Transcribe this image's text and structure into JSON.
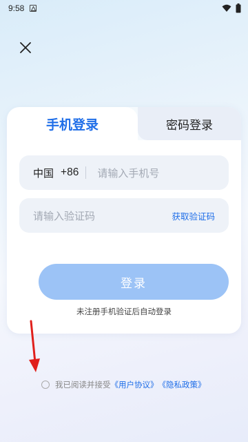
{
  "status_bar": {
    "time": "9:58"
  },
  "tabs": {
    "phone_login": "手机登录",
    "password_login": "密码登录"
  },
  "phone_field": {
    "country": "中国",
    "prefix": "+86",
    "placeholder": "请输入手机号"
  },
  "code_field": {
    "placeholder": "请输入验证码",
    "get_code": "获取验证码"
  },
  "login_button": "登录",
  "auto_register_hint": "未注册手机验证后自动登录",
  "agreement": {
    "text": "我已阅读并接受",
    "user_agreement": "《用户协议》",
    "privacy_policy": "《隐私政策》"
  },
  "colors": {
    "accent": "#1f6ee8",
    "button": "#9cc3f6",
    "arrow": "#e0201c"
  },
  "icons": [
    "notification-icon",
    "wifi-icon",
    "battery-icon",
    "close-icon",
    "arrow-down-icon"
  ]
}
